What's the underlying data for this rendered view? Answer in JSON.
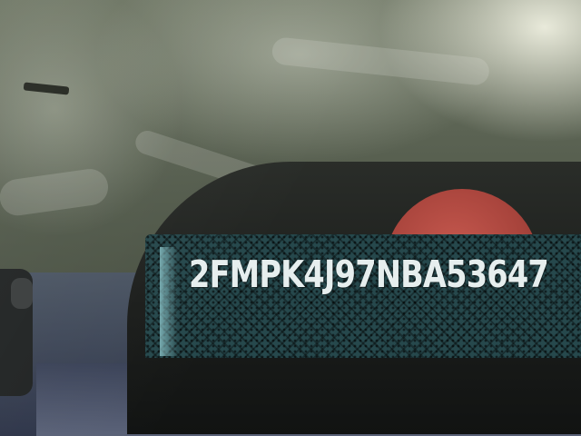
{
  "vin": {
    "text": "2FMPK4J97NBA53647"
  },
  "colors": {
    "windshield": "#535b4c",
    "dashboard": "#1c1e1c",
    "plate_pattern": "#26484c",
    "vin_text": "#e6eeee",
    "sticker_red": "#a8443c"
  }
}
